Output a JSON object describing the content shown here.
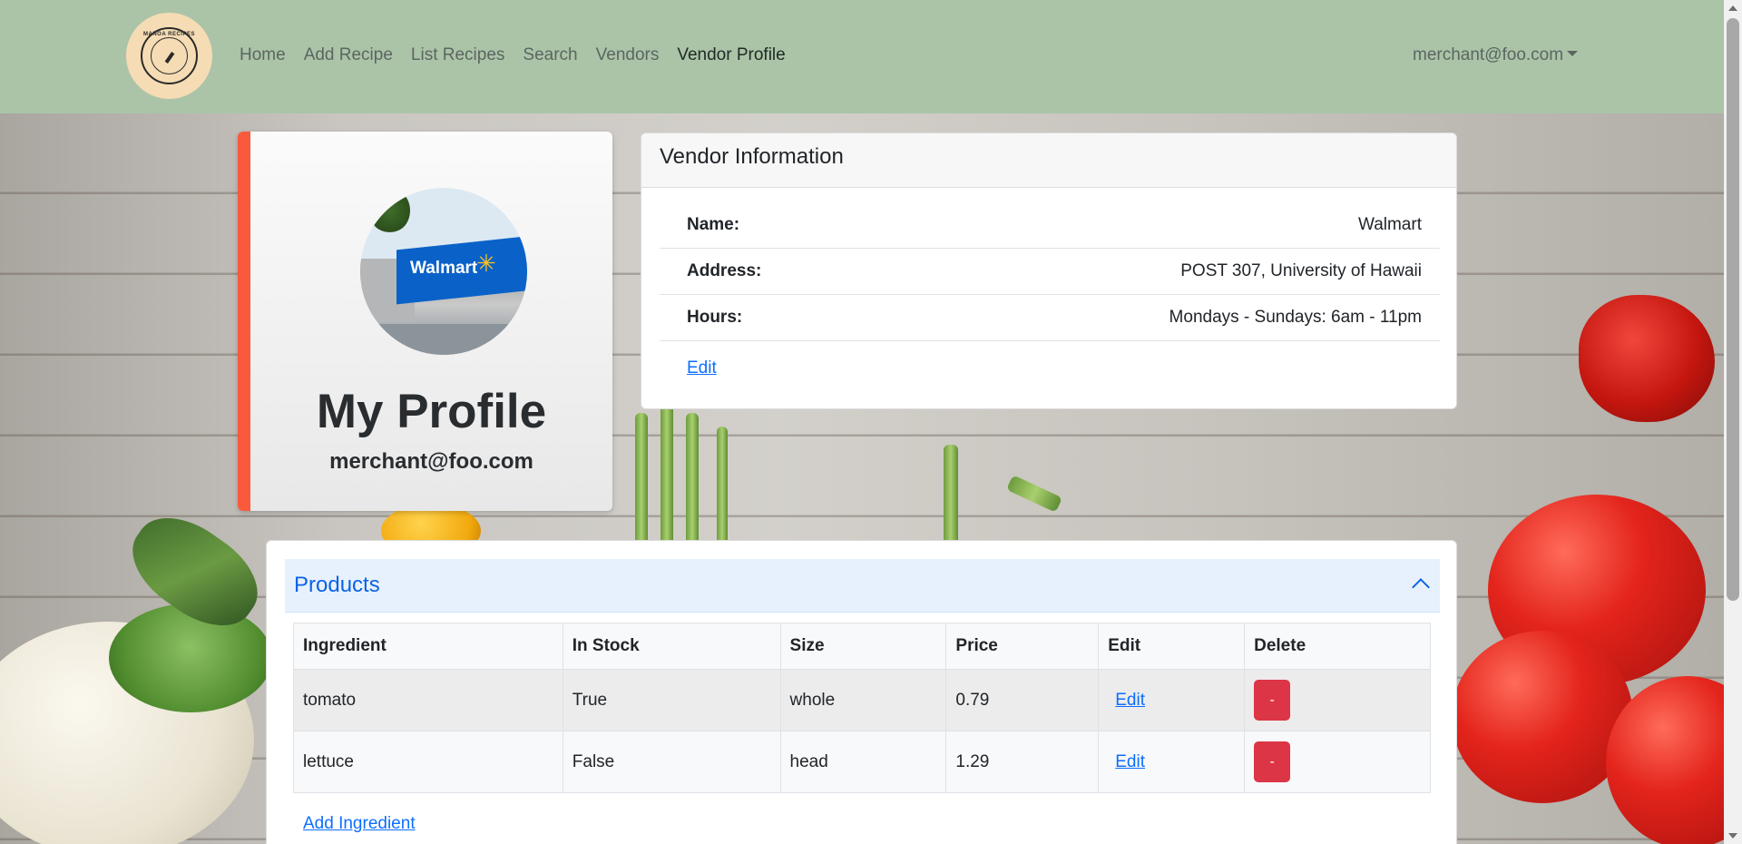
{
  "navbar": {
    "logo_text": "MANOA RECIPES",
    "links": [
      "Home",
      "Add Recipe",
      "List Recipes",
      "Search",
      "Vendors",
      "Vendor Profile"
    ],
    "user": "merchant@foo.com"
  },
  "profile": {
    "title": "My Profile",
    "email": "merchant@foo.com",
    "avatar_sign": "Walmart"
  },
  "vendor": {
    "header": "Vendor Information",
    "name_label": "Name:",
    "name_value": "Walmart",
    "address_label": "Address:",
    "address_value": "POST 307, University of Hawaii",
    "hours_label": "Hours:",
    "hours_value": "Mondays - Sundays: 6am - 11pm",
    "edit_label": "Edit"
  },
  "products": {
    "title": "Products",
    "columns": [
      "Ingredient",
      "In Stock",
      "Size",
      "Price",
      "Edit",
      "Delete"
    ],
    "rows": [
      {
        "ingredient": "tomato",
        "in_stock": "True",
        "size": "whole",
        "price": "0.79",
        "edit": "Edit",
        "delete": "-"
      },
      {
        "ingredient": "lettuce",
        "in_stock": "False",
        "size": "head",
        "price": "1.29",
        "edit": "Edit",
        "delete": "-"
      }
    ],
    "add_label": "Add Ingredient"
  },
  "colors": {
    "navbar": "#abc4a8",
    "profile_accent": "#fa5a3c",
    "link": "#0d6efd",
    "delete": "#dc3545",
    "accordion": "#e7f1fd"
  },
  "icons": [
    "chevron-up-icon",
    "caret-down-icon"
  ]
}
